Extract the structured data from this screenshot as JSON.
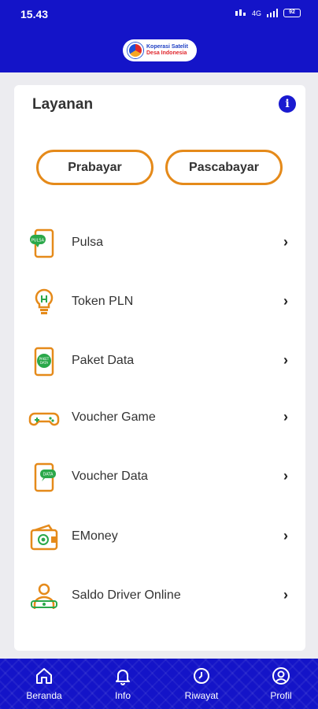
{
  "status_bar": {
    "time": "15.43",
    "network": "4G",
    "battery": "92"
  },
  "header": {
    "logo_line1": "Koperasi Satelit",
    "logo_line2": "Desa Indonesia"
  },
  "card": {
    "title": "Layanan",
    "tabs": [
      {
        "label": "Prabayar"
      },
      {
        "label": "Pascabayar"
      }
    ],
    "items": [
      {
        "label": "Pulsa",
        "icon": "phone-pulsa-icon",
        "badge": "PULSA"
      },
      {
        "label": "Token PLN",
        "icon": "lightbulb-icon"
      },
      {
        "label": "Paket Data",
        "icon": "phone-data-icon",
        "badge": "PAKET DATA"
      },
      {
        "label": "Voucher Game",
        "icon": "gamepad-icon"
      },
      {
        "label": "Voucher Data",
        "icon": "phone-voucher-icon",
        "badge": "DATA"
      },
      {
        "label": "EMoney",
        "icon": "wallet-icon"
      },
      {
        "label": "Saldo Driver Online",
        "icon": "driver-icon"
      }
    ],
    "chevron": "›"
  },
  "bottom_nav": [
    {
      "label": "Beranda",
      "icon": "home-icon"
    },
    {
      "label": "Info",
      "icon": "bell-icon"
    },
    {
      "label": "Riwayat",
      "icon": "clock-icon"
    },
    {
      "label": "Profil",
      "icon": "user-icon"
    }
  ],
  "colors": {
    "primary": "#1414c8",
    "accent": "#e58a1a",
    "green": "#2aa84a"
  }
}
